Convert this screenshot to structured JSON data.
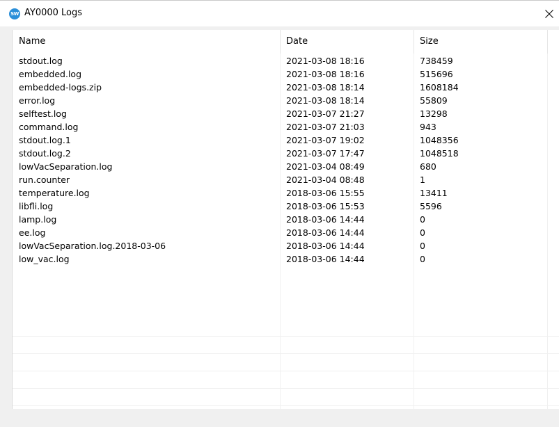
{
  "window": {
    "title": "AY0000 Logs",
    "icon": "sw-app-icon",
    "icon_text": "SW"
  },
  "columns": {
    "name": "Name",
    "date": "Date",
    "size": "Size"
  },
  "files": [
    {
      "name": "stdout.log",
      "date": "2021-03-08 18:16",
      "size": "738459"
    },
    {
      "name": "embedded.log",
      "date": "2021-03-08 18:16",
      "size": "515696"
    },
    {
      "name": "embedded-logs.zip",
      "date": "2021-03-08 18:14",
      "size": "1608184"
    },
    {
      "name": "error.log",
      "date": "2021-03-08 18:14",
      "size": "55809"
    },
    {
      "name": "selftest.log",
      "date": "2021-03-07 21:27",
      "size": "13298"
    },
    {
      "name": "command.log",
      "date": "2021-03-07 21:03",
      "size": "943"
    },
    {
      "name": "stdout.log.1",
      "date": "2021-03-07 19:02",
      "size": "1048356"
    },
    {
      "name": "stdout.log.2",
      "date": "2021-03-07 17:47",
      "size": "1048518"
    },
    {
      "name": "lowVacSeparation.log",
      "date": "2021-03-04 08:49",
      "size": "680"
    },
    {
      "name": "run.counter",
      "date": "2021-03-04 08:48",
      "size": "1"
    },
    {
      "name": "temperature.log",
      "date": "2018-03-06 15:55",
      "size": "13411"
    },
    {
      "name": "libfli.log",
      "date": "2018-03-06 15:53",
      "size": "5596"
    },
    {
      "name": "lamp.log",
      "date": "2018-03-06 14:44",
      "size": "0"
    },
    {
      "name": "ee.log",
      "date": "2018-03-06 14:44",
      "size": "0"
    },
    {
      "name": "lowVacSeparation.log.2018-03-06",
      "date": "2018-03-06 14:44",
      "size": "0"
    },
    {
      "name": "low_vac.log",
      "date": "2018-03-06 14:44",
      "size": "0"
    }
  ],
  "colors": {
    "icon_bg": "#2b8fd9",
    "window_bg": "#f0f0f0",
    "list_bg": "#ffffff",
    "gridline": "#f0f0f0"
  }
}
